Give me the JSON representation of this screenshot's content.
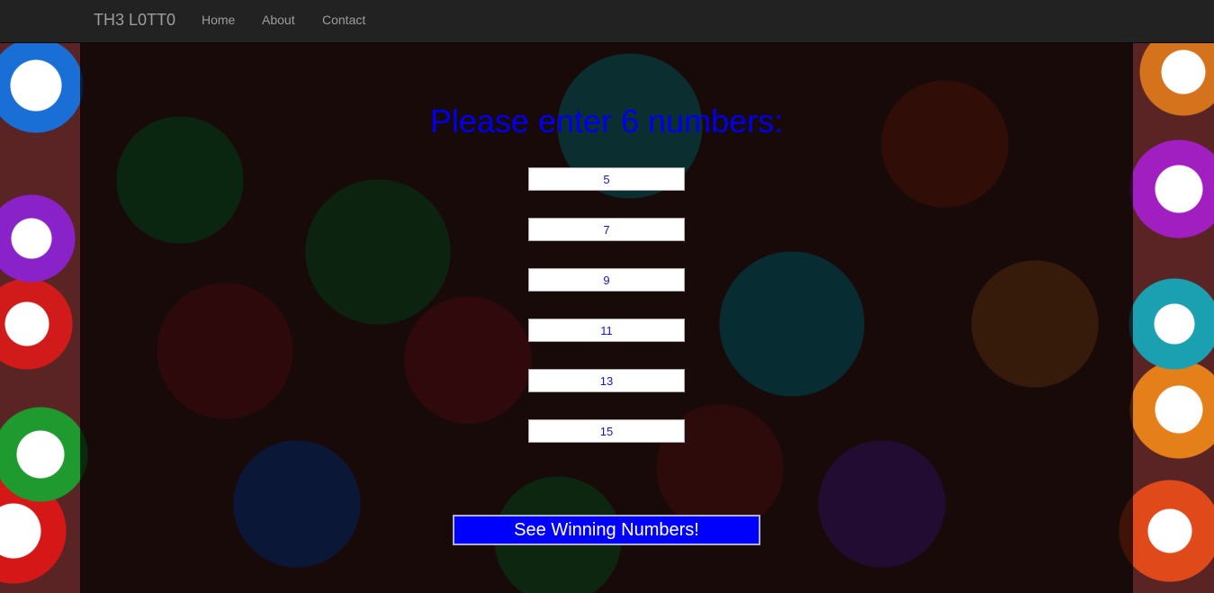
{
  "nav": {
    "brand": "TH3 L0TT0",
    "links": [
      "Home",
      "About",
      "Contact"
    ]
  },
  "form": {
    "heading": "Please enter 6 numbers:",
    "numbers": [
      "5",
      "7",
      "9",
      "11",
      "13",
      "15"
    ],
    "submit_label": "See Winning Numbers!"
  },
  "colors": {
    "heading": "#0000ee",
    "button_bg": "#0000ff",
    "navbar_bg": "#222222"
  }
}
